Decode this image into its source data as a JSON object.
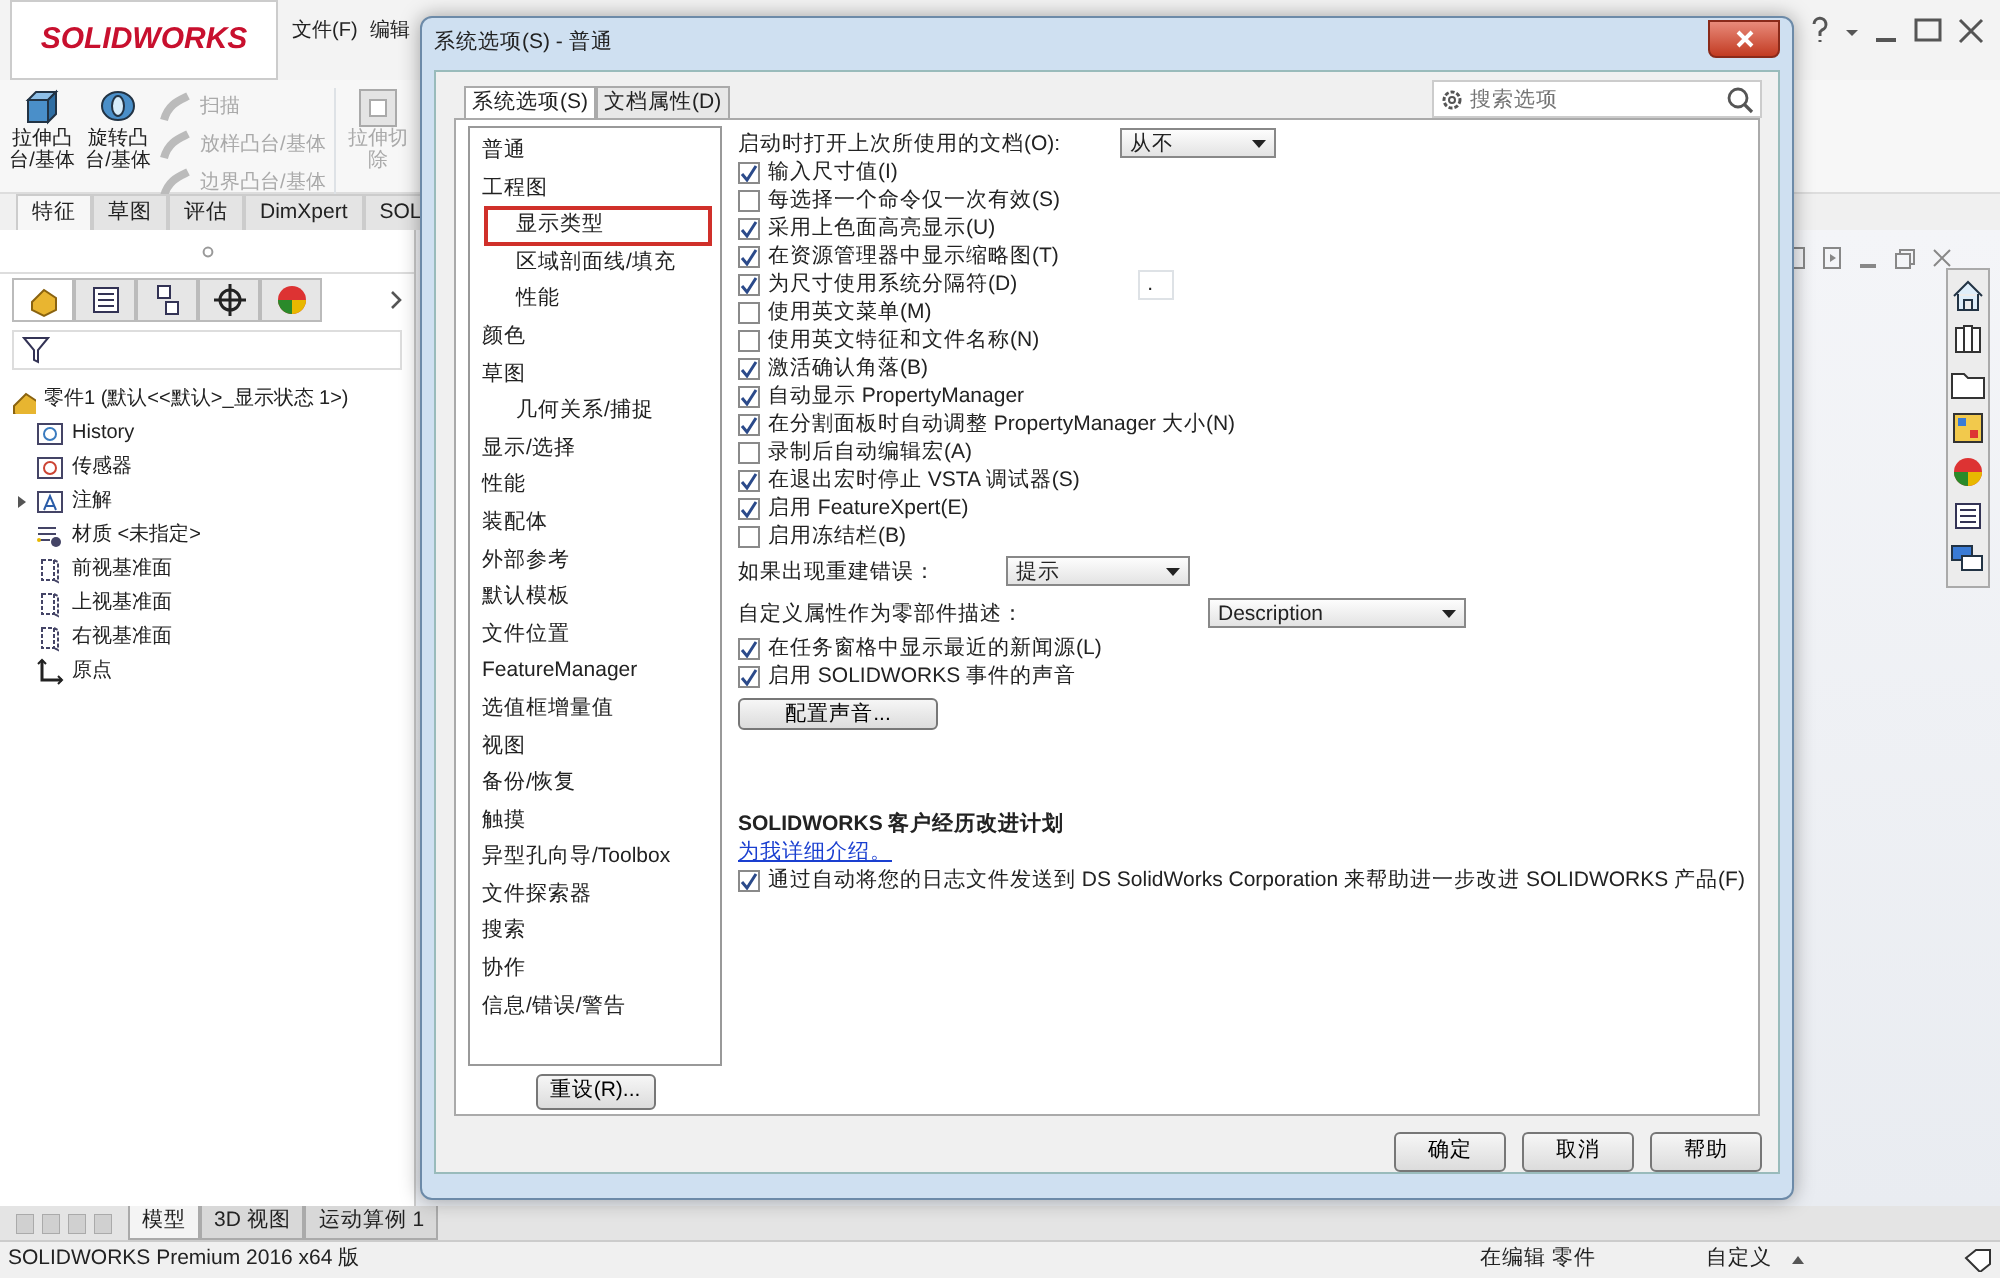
{
  "app": {
    "logo": "SOLIDWORKS",
    "menu": [
      "文件(F)",
      "编辑"
    ],
    "ribbon": [
      {
        "kind": "big",
        "lines": [
          "拉伸凸",
          "台/基体"
        ],
        "disabled": false
      },
      {
        "kind": "big",
        "lines": [
          "旋转凸",
          "台/基体"
        ],
        "disabled": false
      },
      {
        "kind": "small-group",
        "items": [
          {
            "label": "扫描",
            "disabled": true
          },
          {
            "label": "放样凸台/基体",
            "disabled": true
          },
          {
            "label": "边界凸台/基体",
            "disabled": true
          }
        ]
      },
      {
        "kind": "big",
        "lines": [
          "拉伸切",
          "除"
        ],
        "disabled": true
      }
    ],
    "command_tabs": [
      {
        "label": "特征",
        "selected": true
      },
      {
        "label": "草图",
        "selected": false
      },
      {
        "label": "评估",
        "selected": false
      },
      {
        "label": "DimXpert",
        "selected": false
      },
      {
        "label": "SOL",
        "selected": false
      }
    ],
    "panel_tabs": [
      {
        "selected": true
      },
      {
        "selected": false
      },
      {
        "selected": false
      },
      {
        "selected": false
      },
      {
        "selected": false
      }
    ],
    "tree": {
      "label": "零件1 (默认<<默认>_显示状态 1>)",
      "children": [
        {
          "label": "History",
          "expandable": false
        },
        {
          "label": "传感器",
          "expandable": false
        },
        {
          "label": "注解",
          "expandable": true
        },
        {
          "label": "材质 <未指定>",
          "expandable": false
        },
        {
          "label": "前视基准面",
          "expandable": false
        },
        {
          "label": "上视基准面",
          "expandable": false
        },
        {
          "label": "右视基准面",
          "expandable": false
        },
        {
          "label": "原点",
          "expandable": false
        }
      ]
    },
    "sheet_tabs": [
      {
        "label": "模型",
        "selected": true
      },
      {
        "label": "3D 视图",
        "selected": false
      },
      {
        "label": "运动算例 1",
        "selected": false
      }
    ],
    "status_bar": {
      "product": "SOLIDWORKS Premium 2016 x64 版",
      "mode": "在编辑 零件",
      "units": "自定义"
    }
  },
  "dialog": {
    "title": "系统选项(S) - 普通",
    "tabs": [
      {
        "label": "系统选项(S)",
        "selected": true
      },
      {
        "label": "文档属性(D)",
        "selected": false
      }
    ],
    "search": {
      "placeholder": "搜索选项"
    },
    "categories": [
      {
        "label": "普通",
        "highlighted": false
      },
      {
        "label": "工程图",
        "highlighted": false,
        "children": [
          {
            "label": "显示类型",
            "highlighted": true
          },
          {
            "label": "区域剖面线/填充",
            "highlighted": false
          },
          {
            "label": "性能",
            "highlighted": false
          }
        ]
      },
      {
        "label": "颜色",
        "highlighted": false
      },
      {
        "label": "草图",
        "highlighted": false,
        "children": [
          {
            "label": "几何关系/捕捉",
            "highlighted": false
          }
        ]
      },
      {
        "label": "显示/选择",
        "highlighted": false
      },
      {
        "label": "性能",
        "highlighted": false
      },
      {
        "label": "装配体",
        "highlighted": false
      },
      {
        "label": "外部参考",
        "highlighted": false
      },
      {
        "label": "默认模板",
        "highlighted": false
      },
      {
        "label": "文件位置",
        "highlighted": false
      },
      {
        "label": "FeatureManager",
        "highlighted": false
      },
      {
        "label": "选值框增量值",
        "highlighted": false
      },
      {
        "label": "视图",
        "highlighted": false
      },
      {
        "label": "备份/恢复",
        "highlighted": false
      },
      {
        "label": "触摸",
        "highlighted": false
      },
      {
        "label": "异型孔向导/Toolbox",
        "highlighted": false
      },
      {
        "label": "文件探索器",
        "highlighted": false
      },
      {
        "label": "搜索",
        "highlighted": false
      },
      {
        "label": "协作",
        "highlighted": false
      },
      {
        "label": "信息/错误/警告",
        "highlighted": false
      }
    ],
    "reset_button": "重设(R)...",
    "options": [
      {
        "kind": "select",
        "label": "启动时打开上次所使用的文档(O):",
        "value": "从不"
      },
      {
        "kind": "checkbox",
        "label": "输入尺寸值(I)",
        "checked": true
      },
      {
        "kind": "checkbox",
        "label": "每选择一个命令仅一次有效(S)",
        "checked": false
      },
      {
        "kind": "checkbox",
        "label": "采用上色面高亮显示(U)",
        "checked": true
      },
      {
        "kind": "checkbox",
        "label": "在资源管理器中显示缩略图(T)",
        "checked": true
      },
      {
        "kind": "checkbox-field",
        "label": "为尺寸使用系统分隔符(D)",
        "checked": true,
        "value": "."
      },
      {
        "kind": "checkbox",
        "label": "使用英文菜单(M)",
        "checked": false
      },
      {
        "kind": "checkbox",
        "label": "使用英文特征和文件名称(N)",
        "checked": false
      },
      {
        "kind": "checkbox",
        "label": "激活确认角落(B)",
        "checked": true
      },
      {
        "kind": "checkbox",
        "label": "自动显示 PropertyManager",
        "checked": true
      },
      {
        "kind": "checkbox",
        "label": "在分割面板时自动调整 PropertyManager 大小(N)",
        "checked": true
      },
      {
        "kind": "checkbox",
        "label": "录制后自动编辑宏(A)",
        "checked": false
      },
      {
        "kind": "checkbox",
        "label": "在退出宏时停止 VSTA 调试器(S)",
        "checked": true
      },
      {
        "kind": "checkbox",
        "label": "启用 FeatureXpert(E)",
        "checked": true
      },
      {
        "kind": "checkbox",
        "label": "启用冻结栏(B)",
        "checked": false
      },
      {
        "kind": "select",
        "label": "如果出现重建错误：",
        "value": "提示"
      },
      {
        "kind": "select",
        "label": "自定义属性作为零部件描述：",
        "value": "Description"
      },
      {
        "kind": "checkbox",
        "label": "在任务窗格中显示最近的新闻源(L)",
        "checked": true
      },
      {
        "kind": "checkbox",
        "label": "启用 SOLIDWORKS 事件的声音",
        "checked": true
      },
      {
        "kind": "button",
        "label": "配置声音..."
      },
      {
        "kind": "heading",
        "label": "SOLIDWORKS 客户经历改进计划"
      },
      {
        "kind": "link",
        "label": "为我详细介绍。"
      },
      {
        "kind": "checkbox",
        "label": "通过自动将您的日志文件发送到 DS SolidWorks Corporation 来帮助进一步改进 SOLIDWORKS 产品(F)",
        "checked": true
      }
    ],
    "buttons": [
      "确定",
      "取消",
      "帮助"
    ]
  }
}
